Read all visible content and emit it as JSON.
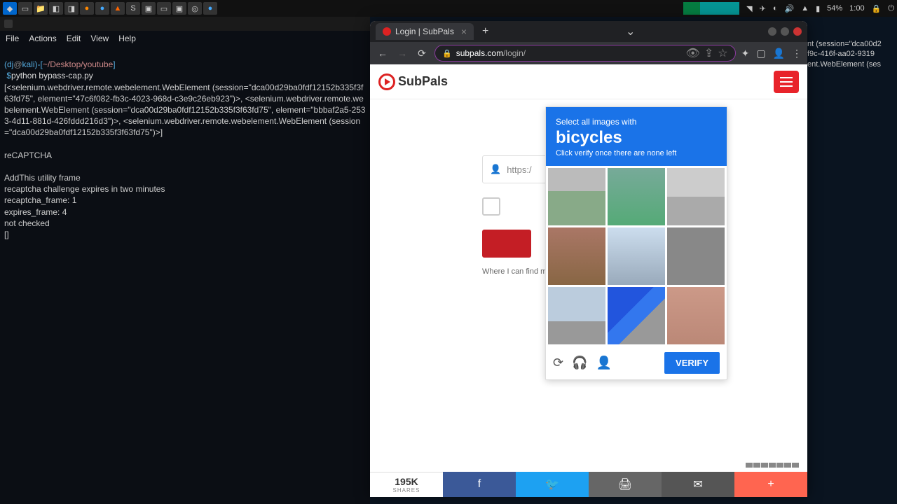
{
  "taskbar": {
    "battery_pct": "54%",
    "time": "1:00"
  },
  "terminal": {
    "menus": [
      "File",
      "Actions",
      "Edit",
      "View",
      "Help"
    ],
    "prompt_user": "dj",
    "prompt_host": "kali",
    "prompt_path": "~/Desktop/youtube",
    "command": "python bypass-cap.py",
    "output1": "[<selenium.webdriver.remote.webelement.WebElement (session=\"dca00d29ba0fdf12152b335f3f63fd75\", element=\"47c6f082-fb3c-4023-968d-c3e9c26eb923\")>, <selenium.webdriver.remote.webelement.WebElement (session=\"dca00d29ba0fdf12152b335f3f63fd75\", element=\"bbbaf2a5-2533-4d11-881d-426fddd216d3\")>, <selenium.webdriver.remote.webelement.WebElement (session=\"dca00d29ba0fdf12152b335f3f63fd75\")>]",
    "output2": "reCAPTCHA",
    "output3": "AddThis utility frame",
    "output4": "recaptcha challenge expires in two minutes",
    "output5": "recaptcha_frame: 1",
    "output6": "expires_frame: 4",
    "output7": "not checked",
    "output8": "[]"
  },
  "right_term": {
    "line1": "nt (session=\"dca00d2",
    "line2": "f9c-416f-aa02-9319",
    "line3": "ent.WebElement (ses"
  },
  "browser": {
    "tab_title": "Login | SubPals",
    "url_domain": "subpals.com",
    "url_path": "/login/"
  },
  "site": {
    "logo_text": "SubPals",
    "input_placeholder": "https:/",
    "help_text": "Where I can find m",
    "share_count": "195K",
    "share_label": "SHARES"
  },
  "captcha": {
    "instruction": "Select all images with",
    "target": "bicycles",
    "subtext": "Click verify once there are none left",
    "verify": "VERIFY"
  }
}
